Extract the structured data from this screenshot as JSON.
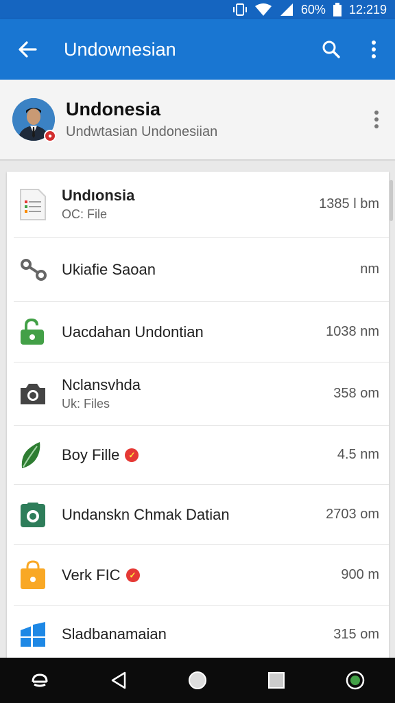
{
  "status": {
    "battery": "60%",
    "time": "12:219"
  },
  "appbar": {
    "title": "Undownesian"
  },
  "profile": {
    "name": "Undonesia",
    "subtitle": "Undwtasian Undonesiian"
  },
  "items": [
    {
      "title": "Undıonsia",
      "subtitle": "OC: File",
      "size": "1385 l bm",
      "icon": "document-icon",
      "verified": false,
      "bold": true
    },
    {
      "title": "Ukiafie Saoan",
      "subtitle": "",
      "size": "nm",
      "icon": "link-icon",
      "verified": false,
      "bold": false
    },
    {
      "title": "Uacdahan Undontian",
      "subtitle": "",
      "size": "1038 nm",
      "icon": "unlock-icon",
      "verified": false,
      "bold": false
    },
    {
      "title": "Nclansvhda",
      "subtitle": "Uk: Files",
      "size": "358 om",
      "icon": "camera-icon",
      "verified": false,
      "bold": false
    },
    {
      "title": "Boy Fille",
      "subtitle": "",
      "size": "4.5 nm",
      "icon": "leaf-icon",
      "verified": true,
      "bold": false
    },
    {
      "title": "Undanskn Chmak Datian",
      "subtitle": "",
      "size": "2703 om",
      "icon": "photo-icon",
      "verified": false,
      "bold": false
    },
    {
      "title": "Verk FIC",
      "subtitle": "",
      "size": "900  m",
      "icon": "bag-icon",
      "verified": true,
      "bold": false
    },
    {
      "title": "Sladbanamaian",
      "subtitle": "",
      "size": "315 om",
      "icon": "windows-icon",
      "verified": false,
      "bold": false
    }
  ],
  "colors": {
    "status_bar": "#1565c0",
    "app_bar": "#1976d2",
    "nav_bar": "#0c0c0c"
  }
}
